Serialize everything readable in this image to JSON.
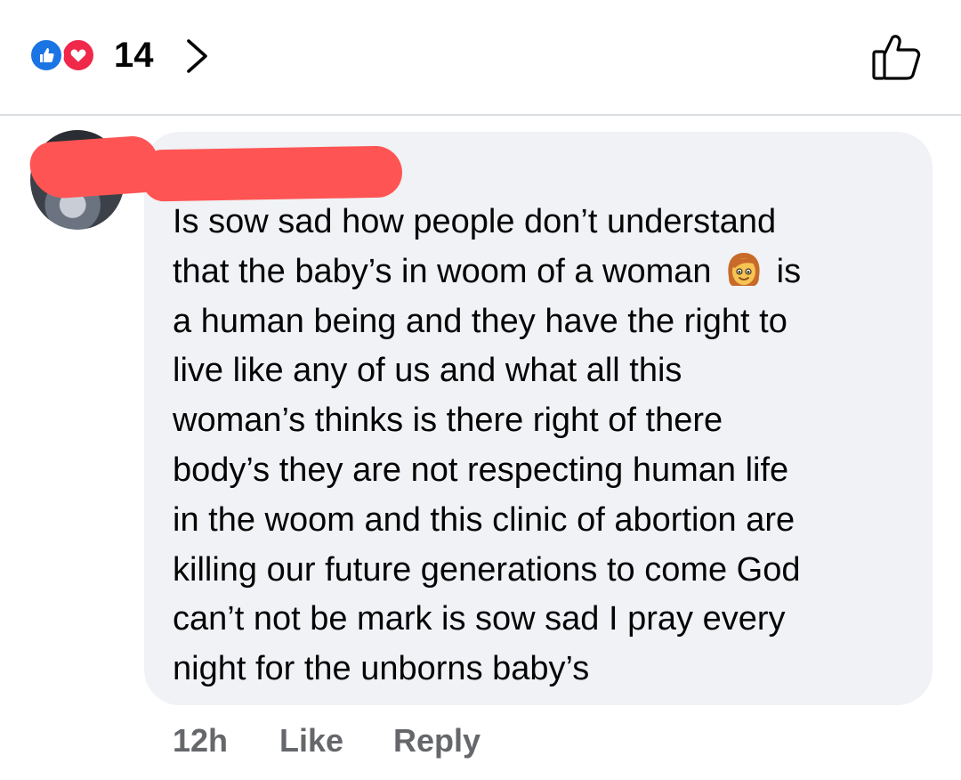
{
  "reactions": {
    "count": "14",
    "types": [
      "like",
      "love"
    ],
    "icons": [
      "thumbs-up-icon",
      "heart-icon",
      "chevron-right-icon",
      "thumbs-up-outline-icon"
    ],
    "colors": {
      "like": "#1b74e4",
      "love": "#f0284a"
    }
  },
  "comment": {
    "author": "",
    "lines": [
      "Is sow sad how people don’t understand",
      "that the baby’s in woom of a woman",
      "a human being and they have the right to",
      "live like any of us and what all this",
      "woman’s thinks is there right of there",
      "body’s they are not respecting human life",
      "in the woom and this clinic of abortion are",
      "killing our future generations to come God",
      "can’t not be mark is sow sad I pray every",
      "night for the unborns baby’s"
    ],
    "line2_suffix": "is",
    "emoji": "woman-emoji",
    "bubble_color": "#f0f2f5"
  },
  "actions": {
    "time": "12h",
    "like_label": "Like",
    "reply_label": "Reply"
  }
}
